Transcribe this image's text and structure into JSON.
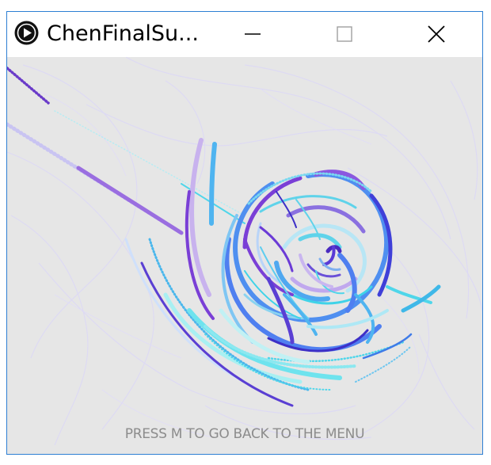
{
  "window": {
    "title": "ChenFinalSu...",
    "controls": {
      "minimize_icon": "minimize-icon",
      "maximize_icon": "maximize-icon",
      "close_icon": "close-icon"
    },
    "app_icon": "play-icon"
  },
  "canvas": {
    "instruction": "PRESS M TO GO BACK TO THE MENU",
    "colors": {
      "background": "#e6e6e6",
      "violet": "#7a3fd6",
      "blue": "#3f7be8",
      "cyan": "#3fd3e8",
      "lavender": "#b8b4f5",
      "text": "#8c8c8c"
    }
  }
}
